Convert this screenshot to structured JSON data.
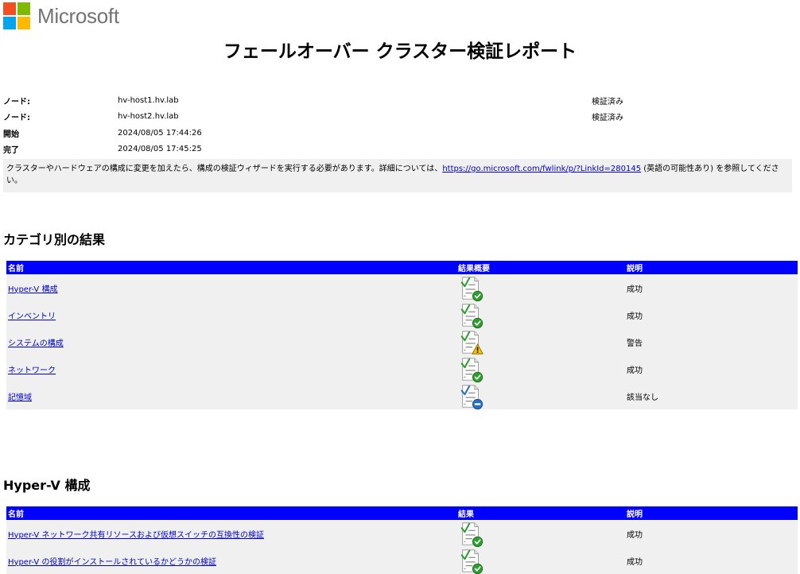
{
  "brand": {
    "name": "Microsoft",
    "colors": [
      "#f25022",
      "#7fba00",
      "#00a4ef",
      "#ffb900"
    ]
  },
  "report": {
    "title": "フェールオーバー クラスター検証レポート"
  },
  "info": [
    {
      "key": "ノード:",
      "value": "hv-host1.hv.lab",
      "status": "検証済み"
    },
    {
      "key": "ノード:",
      "value": "hv-host2.hv.lab",
      "status": "検証済み"
    },
    {
      "key": "開始",
      "value": "2024/08/05 17:44:26",
      "status": ""
    },
    {
      "key": "完了",
      "value": "2024/08/05 17:45:25",
      "status": ""
    }
  ],
  "notice": {
    "before": "クラスターやハードウェアの構成に変更を加えたら、構成の検証ウィザードを実行する必要があります。詳細については、",
    "link": "https://go.microsoft.com/fwlink/p/?LinkId=280145",
    "after": " (英語の可能性あり) を参照してください。"
  },
  "category_section": {
    "title": "カテゴリ別の結果",
    "columns": [
      "名前",
      "結果概要",
      "説明"
    ],
    "rows": [
      {
        "name": "Hyper-V 構成",
        "icon": "success-icon",
        "desc": "成功"
      },
      {
        "name": "インベントリ",
        "icon": "success-icon",
        "desc": "成功"
      },
      {
        "name": "システムの構成",
        "icon": "warning-icon",
        "desc": "警告"
      },
      {
        "name": "ネットワーク",
        "icon": "success-icon",
        "desc": "成功"
      },
      {
        "name": "記憶域",
        "icon": "not-applicable-icon",
        "desc": "該当なし"
      }
    ]
  },
  "hyperv_section": {
    "title": "Hyper-V 構成",
    "columns": [
      "名前",
      "結果",
      "説明"
    ],
    "rows": [
      {
        "name": "Hyper-V ネットワーク共有リソースおよび仮想スイッチの互換性の検証",
        "icon": "success-icon",
        "desc": "成功"
      },
      {
        "name": "Hyper-V の役割がインストールされているかどうかの検証",
        "icon": "success-icon",
        "desc": "成功"
      }
    ]
  },
  "colors": {
    "header_bg": "#0000ff",
    "row_bg": "#f0f0f0",
    "link": "#0000cc",
    "success": "#2e9e2e",
    "warning": "#f2c200",
    "not_applicable": "#2c6fbf"
  }
}
